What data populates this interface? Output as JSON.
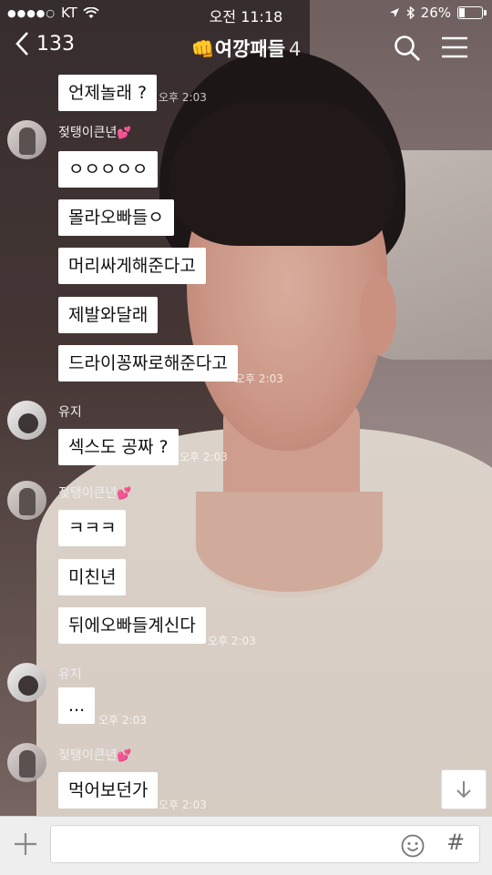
{
  "status_bar": {
    "signal_dots": "●●●●○",
    "carrier": "KT",
    "time": "오전 11:18",
    "battery": "26%",
    "battery_level": 0.26
  },
  "header": {
    "back_count": "133",
    "title_emoji": "👊",
    "title": "여깡패들",
    "member_count": "4"
  },
  "messages": [
    {
      "type": "bubble",
      "text": "언제놀래 ?",
      "time": "오후 2:03"
    },
    {
      "type": "sender",
      "name": "젖탱이큰년",
      "heart": "💕"
    },
    {
      "type": "bubble",
      "text": "ㅇㅇㅇㅇㅇ"
    },
    {
      "type": "bubble",
      "text": "몰라오빠들ㅇ"
    },
    {
      "type": "bubble",
      "text": "머리싸게해준다고"
    },
    {
      "type": "bubble",
      "text": "제발와달래"
    },
    {
      "type": "bubble",
      "text": "드라이꽁짜로해준다고",
      "time": "오후 2:03"
    },
    {
      "type": "sender",
      "name": "유지"
    },
    {
      "type": "bubble",
      "text": "섹스도 공짜 ?",
      "time": "오후 2:03"
    },
    {
      "type": "sender",
      "name": "젖탱이큰년",
      "heart": "💕"
    },
    {
      "type": "bubble",
      "text": "ㅋㅋㅋ"
    },
    {
      "type": "bubble",
      "text": "미친년"
    },
    {
      "type": "bubble",
      "text": "뒤에오빠들계신다",
      "time": "오후 2:03"
    },
    {
      "type": "sender",
      "name": "유지"
    },
    {
      "type": "bubble",
      "text": "...",
      "time": "오후 2:03"
    },
    {
      "type": "sender",
      "name": "젖탱이큰년",
      "heart": "💕"
    },
    {
      "type": "bubble",
      "text": "먹어보던가",
      "time": "오후 2:03"
    }
  ],
  "input": {
    "placeholder": "",
    "hash_symbol": "#"
  },
  "icons": {
    "back": "chevron-left-icon",
    "search": "search-icon",
    "menu": "hamburger-menu-icon",
    "scroll_down": "arrow-down-icon",
    "add": "plus-icon",
    "emoji": "emoji-icon"
  }
}
